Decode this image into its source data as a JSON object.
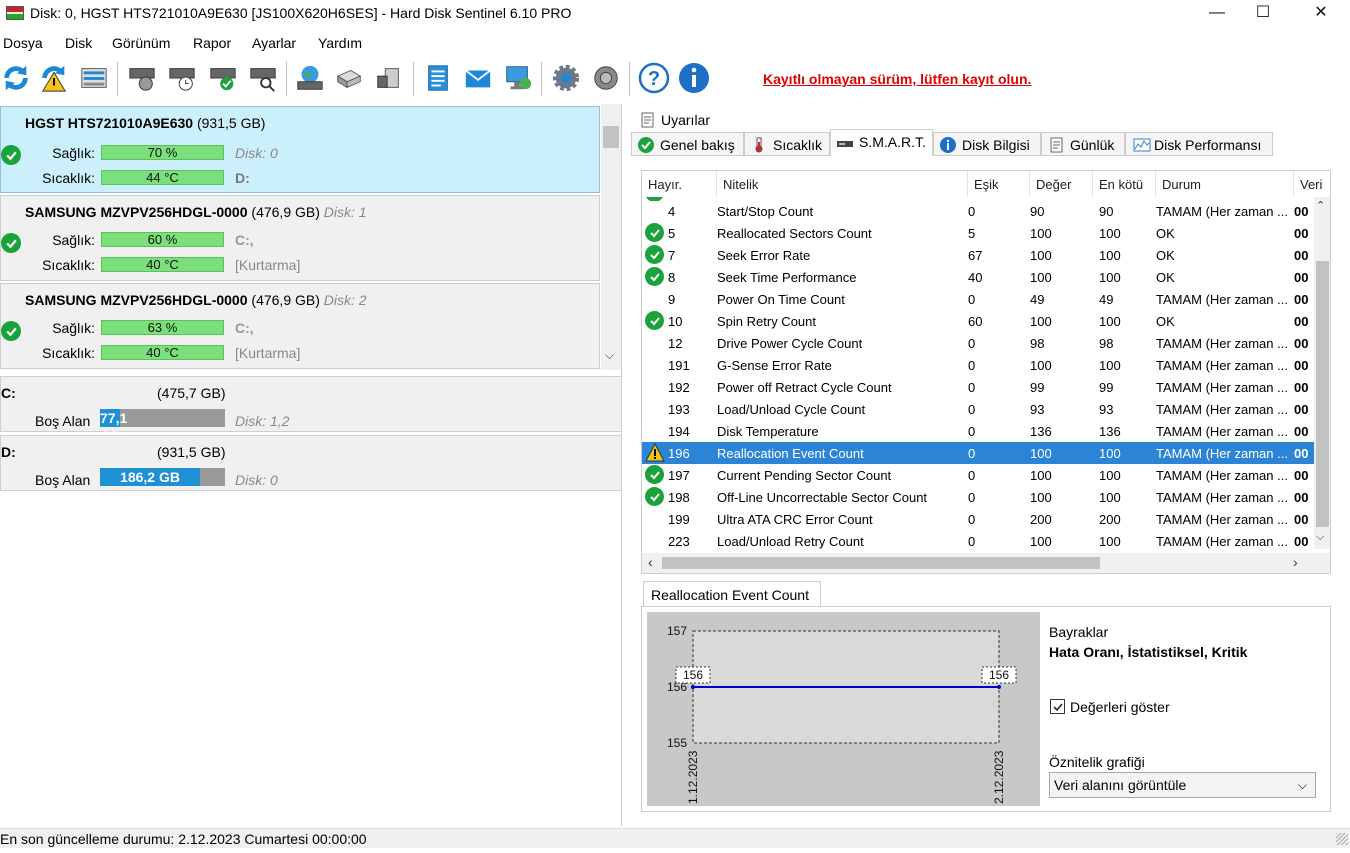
{
  "window": {
    "title": "Disk: 0, HGST HTS721010A9E630 [JS100X620H6SES]  -  Hard Disk Sentinel 6.10 PRO",
    "minimize": "—",
    "maximize": "☐",
    "close": "✕"
  },
  "menu": [
    "Dosya",
    "Disk",
    "Görünüm",
    "Rapor",
    "Ayarlar",
    "Yardım"
  ],
  "toolbar": {
    "register_notice": "Kayıtlı olmayan sürüm, lütfen kayıt olun.",
    "icons": [
      "refresh-icon",
      "refresh-warning-icon",
      "disk-list-icon",
      "disk-sound-icon",
      "disk-clock-icon",
      "disk-ok-icon",
      "disk-search-icon",
      "world-disk-icon",
      "usb-drive-icon",
      "external-drive-icon",
      "report-icon",
      "mail-icon",
      "network-icon",
      "gear-icon",
      "speaker-icon",
      "help-icon",
      "info-icon"
    ]
  },
  "disks": [
    {
      "name": "HGST HTS721010A9E630",
      "size": "(931,5 GB)",
      "disk_label": "",
      "health_label": "Sağlık:",
      "health": "70 %",
      "health_extra": "Disk: 0",
      "temp_label": "Sıcaklık:",
      "temp": "44 °C",
      "temp_extra": "D:"
    },
    {
      "name": "SAMSUNG MZVPV256HDGL-0000",
      "size": "(476,9 GB)",
      "disk_label": "Disk: 1",
      "health_label": "Sağlık:",
      "health": "60 %",
      "health_extra": "C:,",
      "temp_label": "Sıcaklık:",
      "temp": "40 °C",
      "temp_extra": "[Kurtarma]"
    },
    {
      "name": "SAMSUNG MZVPV256HDGL-0000",
      "size": "(476,9 GB)",
      "disk_label": "Disk: 2",
      "health_label": "Sağlık:",
      "health": "63 %",
      "health_extra": "C:,",
      "temp_label": "Sıcaklık:",
      "temp": "40 °C",
      "temp_extra": "[Kurtarma]"
    }
  ],
  "partitions": [
    {
      "letter": "C:",
      "size": "(475,7 GB)",
      "free_label": "Boş Alan",
      "free": "77,1 GB",
      "free_fraction": 0.16,
      "disk": "Disk: 1,2"
    },
    {
      "letter": "D:",
      "size": "(931,5 GB)",
      "free_label": "Boş Alan",
      "free": "186,2 GB",
      "free_fraction": 0.8,
      "disk": "Disk: 0"
    }
  ],
  "tabs_top": {
    "alerts": "Uyarılar"
  },
  "tabs": [
    "Genel bakış",
    "Sıcaklık",
    "S.M.A.R.T.",
    "Disk Bilgisi",
    "Günlük",
    "Disk Performansı"
  ],
  "smart": {
    "columns": [
      "Hayır.",
      "Nitelik",
      "Eşik",
      "Değer",
      "En kötü",
      "Durum",
      "Veri"
    ],
    "rows": [
      {
        "id": "4",
        "name": "Start/Stop Count",
        "thr": "0",
        "val": "90",
        "worst": "90",
        "status": "TAMAM (Her zaman ...",
        "data": "00",
        "icon": ""
      },
      {
        "id": "5",
        "name": "Reallocated Sectors Count",
        "thr": "5",
        "val": "100",
        "worst": "100",
        "status": "OK",
        "data": "00",
        "icon": "ok"
      },
      {
        "id": "7",
        "name": "Seek Error Rate",
        "thr": "67",
        "val": "100",
        "worst": "100",
        "status": "OK",
        "data": "00",
        "icon": "ok"
      },
      {
        "id": "8",
        "name": "Seek Time Performance",
        "thr": "40",
        "val": "100",
        "worst": "100",
        "status": "OK",
        "data": "00",
        "icon": "ok"
      },
      {
        "id": "9",
        "name": "Power On Time Count",
        "thr": "0",
        "val": "49",
        "worst": "49",
        "status": "TAMAM (Her zaman ...",
        "data": "00",
        "icon": ""
      },
      {
        "id": "10",
        "name": "Spin Retry Count",
        "thr": "60",
        "val": "100",
        "worst": "100",
        "status": "OK",
        "data": "00",
        "icon": "ok"
      },
      {
        "id": "12",
        "name": "Drive Power Cycle Count",
        "thr": "0",
        "val": "98",
        "worst": "98",
        "status": "TAMAM (Her zaman ...",
        "data": "00",
        "icon": ""
      },
      {
        "id": "191",
        "name": "G-Sense Error Rate",
        "thr": "0",
        "val": "100",
        "worst": "100",
        "status": "TAMAM (Her zaman ...",
        "data": "00",
        "icon": ""
      },
      {
        "id": "192",
        "name": "Power off Retract Cycle Count",
        "thr": "0",
        "val": "99",
        "worst": "99",
        "status": "TAMAM (Her zaman ...",
        "data": "00",
        "icon": ""
      },
      {
        "id": "193",
        "name": "Load/Unload Cycle Count",
        "thr": "0",
        "val": "93",
        "worst": "93",
        "status": "TAMAM (Her zaman ...",
        "data": "00",
        "icon": ""
      },
      {
        "id": "194",
        "name": "Disk Temperature",
        "thr": "0",
        "val": "136",
        "worst": "136",
        "status": "TAMAM (Her zaman ...",
        "data": "00",
        "icon": ""
      },
      {
        "id": "196",
        "name": "Reallocation Event Count",
        "thr": "0",
        "val": "100",
        "worst": "100",
        "status": "TAMAM (Her zaman ...",
        "data": "00",
        "icon": "warn",
        "selected": true
      },
      {
        "id": "197",
        "name": "Current Pending Sector Count",
        "thr": "0",
        "val": "100",
        "worst": "100",
        "status": "TAMAM (Her zaman ...",
        "data": "00",
        "icon": "ok"
      },
      {
        "id": "198",
        "name": "Off-Line Uncorrectable Sector Count",
        "thr": "0",
        "val": "100",
        "worst": "100",
        "status": "TAMAM (Her zaman ...",
        "data": "00",
        "icon": "ok"
      },
      {
        "id": "199",
        "name": "Ultra ATA CRC Error Count",
        "thr": "0",
        "val": "200",
        "worst": "200",
        "status": "TAMAM (Her zaman ...",
        "data": "00",
        "icon": ""
      },
      {
        "id": "223",
        "name": "Load/Unload Retry Count",
        "thr": "0",
        "val": "100",
        "worst": "100",
        "status": "TAMAM (Her zaman ...",
        "data": "00",
        "icon": ""
      }
    ]
  },
  "detail": {
    "tab": "Reallocation Event Count",
    "flags_label": "Bayraklar",
    "flags": "Hata Oranı, İstatistiksel, Kritik",
    "show_values_label": "Değerleri göster",
    "show_values": true,
    "graph_label": "Öznitelik grafiği",
    "graph_select": "Veri alanını görüntüle"
  },
  "chart_data": {
    "type": "line",
    "x": [
      "1.12.2023",
      "2.12.2023"
    ],
    "series": [
      {
        "values": [
          156,
          156
        ]
      }
    ],
    "yticks": [
      "157",
      "156",
      "155"
    ],
    "ylim": [
      155,
      157
    ],
    "data_labels": [
      "156",
      "156"
    ],
    "line_color": "#0000cc"
  },
  "status": {
    "text": "En son güncelleme durumu: 2.12.2023 Cumartesi 00:00:00"
  }
}
